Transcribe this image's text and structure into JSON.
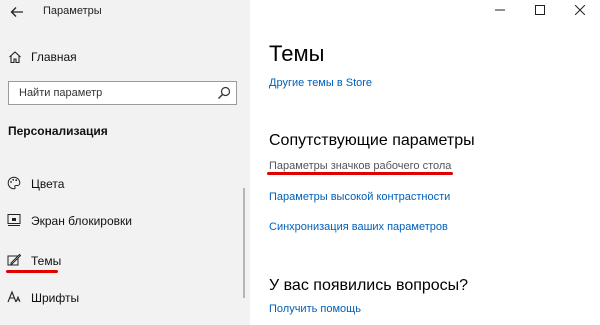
{
  "window": {
    "title": "Параметры"
  },
  "sidebar": {
    "home_label": "Главная",
    "search_placeholder": "Найти параметр",
    "section_heading": "Персонализация",
    "items": [
      {
        "label": "Цвета",
        "icon": "palette-icon"
      },
      {
        "label": "Экран блокировки",
        "icon": "lock-screen-icon"
      },
      {
        "label": "Темы",
        "icon": "themes-icon"
      },
      {
        "label": "Шрифты",
        "icon": "fonts-icon"
      }
    ]
  },
  "main": {
    "title": "Темы",
    "store_link": "Другие темы в Store",
    "related_heading": "Сопутствующие параметры",
    "related_links": [
      "Параметры значков рабочего стола",
      "Параметры высокой контрастности",
      "Синхронизация ваших параметров"
    ],
    "questions_heading": "У вас появились вопросы?",
    "help_link": "Получить помощь"
  },
  "colors": {
    "accent_link": "#0060b8",
    "highlight_underline": "#e00000",
    "sidebar_bg": "#f2f2f2"
  }
}
